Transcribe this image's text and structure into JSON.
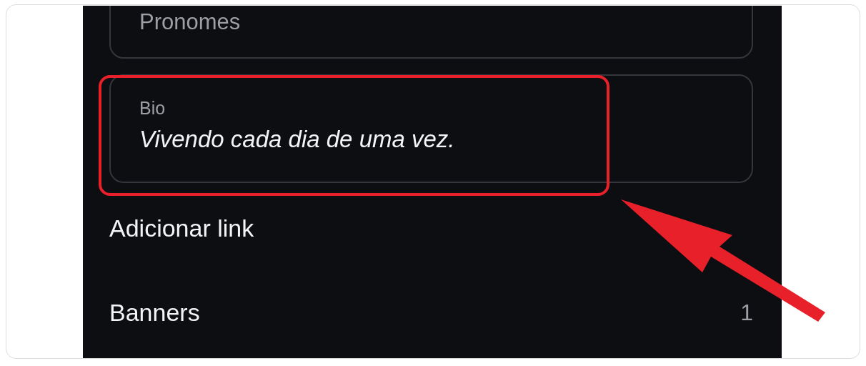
{
  "fields": [
    {
      "label": "Pronomes"
    },
    {
      "label": "Bio",
      "value": "Vivendo cada dia de uma vez."
    }
  ],
  "items": [
    {
      "label": "Adicionar link"
    },
    {
      "label": "Banners",
      "count": "1"
    }
  ]
}
